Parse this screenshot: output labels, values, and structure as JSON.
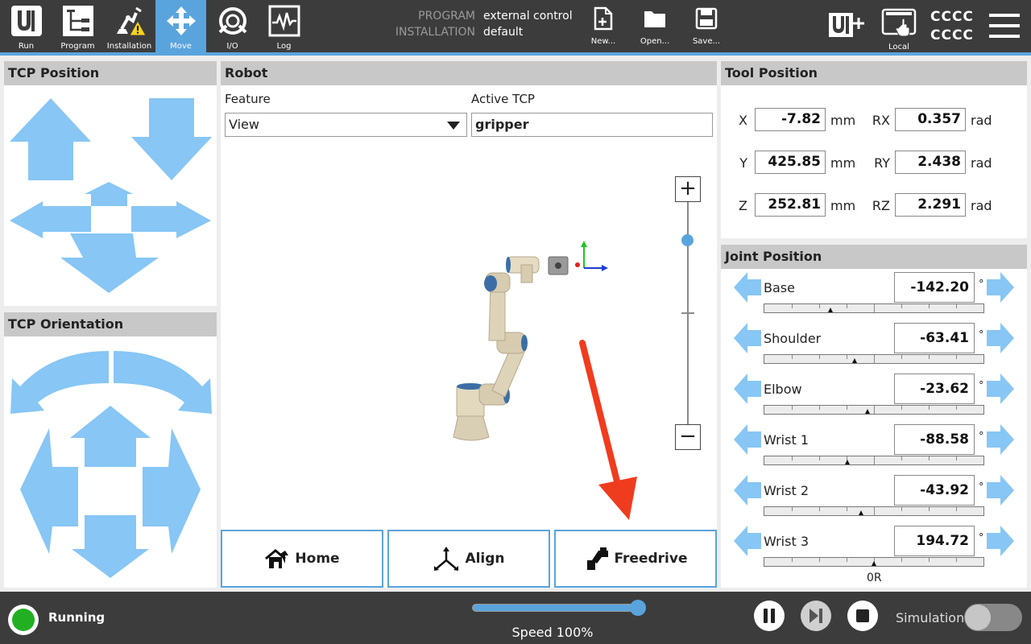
{
  "nav": {
    "tabs": [
      {
        "label": "Run",
        "icon": "ur-logo-icon"
      },
      {
        "label": "Program",
        "icon": "program-icon"
      },
      {
        "label": "Installation",
        "icon": "installation-warning-icon"
      },
      {
        "label": "Move",
        "icon": "move-icon",
        "active": true
      },
      {
        "label": "I/O",
        "icon": "io-icon"
      },
      {
        "label": "Log",
        "icon": "log-icon"
      }
    ]
  },
  "program": {
    "program_label": "PROGRAM",
    "program_value": "external control",
    "installation_label": "INSTALLATION",
    "installation_value": "default"
  },
  "file_buttons": {
    "new": "New...",
    "open": "Open...",
    "save": "Save..."
  },
  "top_right": {
    "local_label": "Local",
    "user_line1": "CCCC",
    "user_line2": "CCCC"
  },
  "tcp_position": {
    "title": "TCP Position"
  },
  "tcp_orientation": {
    "title": "TCP Orientation"
  },
  "robot": {
    "title": "Robot",
    "feature_label": "Feature",
    "feature_value": "View",
    "active_tcp_label": "Active TCP",
    "active_tcp_value": "gripper",
    "zoom_in": "+",
    "zoom_out": "−",
    "zoom_level": 0.17
  },
  "actions": {
    "home": "Home",
    "align": "Align",
    "freedrive": "Freedrive"
  },
  "tool_position": {
    "title": "Tool Position",
    "x_label": "X",
    "x_value": "-7.82",
    "x_unit": "mm",
    "y_label": "Y",
    "y_value": "425.85",
    "y_unit": "mm",
    "z_label": "Z",
    "z_value": "252.81",
    "z_unit": "mm",
    "rx_label": "RX",
    "rx_value": "0.357",
    "rx_unit": "rad",
    "ry_label": "RY",
    "ry_value": "2.438",
    "ry_unit": "rad",
    "rz_label": "RZ",
    "rz_value": "2.291",
    "rz_unit": "rad"
  },
  "joint_position": {
    "title": "Joint Position",
    "unit": "°",
    "joints": [
      {
        "name": "Base",
        "value": "-142.20",
        "pos": 0.3
      },
      {
        "name": "Shoulder",
        "value": "-63.41",
        "pos": 0.41
      },
      {
        "name": "Elbow",
        "value": "-23.62",
        "pos": 0.47
      },
      {
        "name": "Wrist 1",
        "value": "-88.58",
        "pos": 0.38
      },
      {
        "name": "Wrist 2",
        "value": "-43.92",
        "pos": 0.44
      },
      {
        "name": "Wrist 3",
        "value": "194.72",
        "pos": 0.5
      }
    ],
    "footer": "0R"
  },
  "status": {
    "state": "Running",
    "speed_label": "Speed 100%",
    "speed": 1.0,
    "simulation_label": "Simulation"
  },
  "colors": {
    "accent": "#5aa4dd",
    "arrow_fill": "#87c6f5",
    "topbar": "#3c3c3c",
    "running": "#22b022",
    "annotation_arrow": "#f03c1e"
  }
}
